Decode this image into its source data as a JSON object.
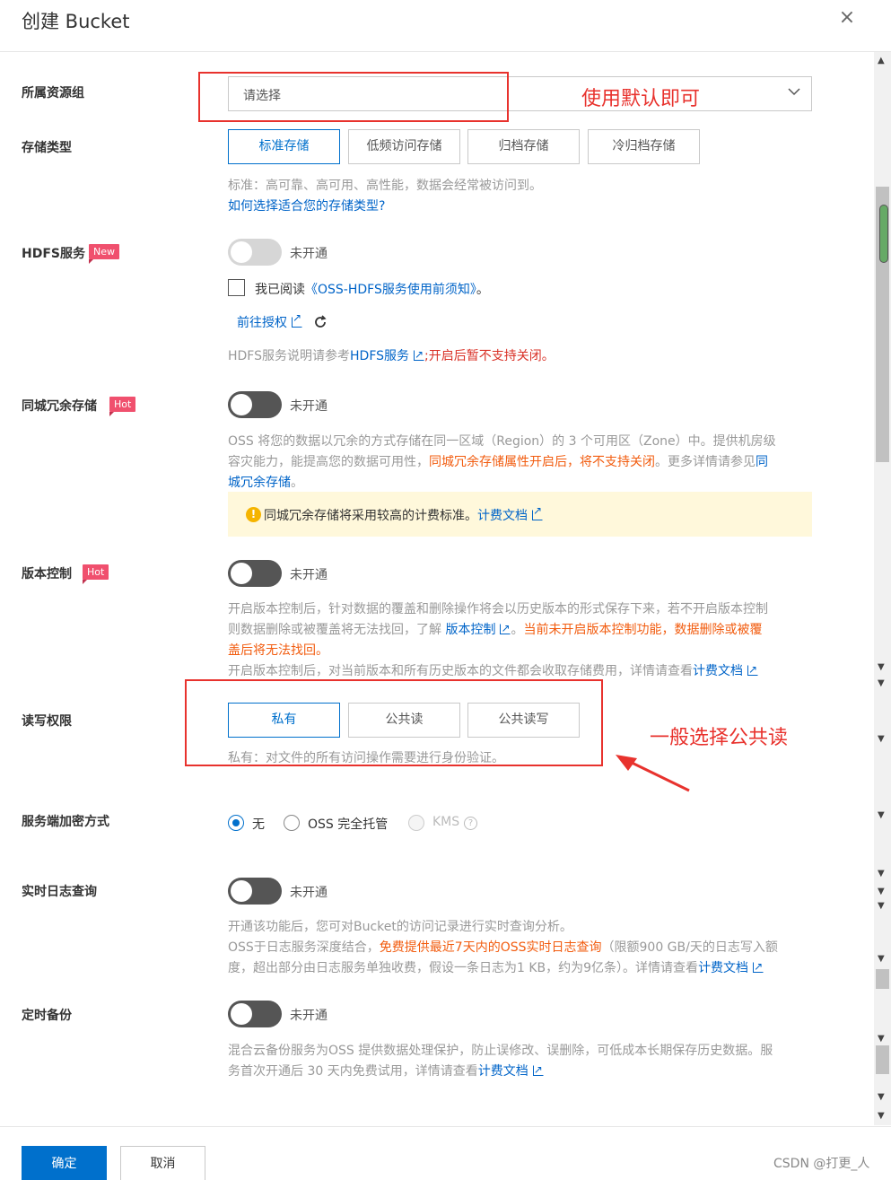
{
  "dialog": {
    "title": "创建 Bucket",
    "close": "×"
  },
  "resource_group": {
    "label": "所属资源组",
    "placeholder": "请选择"
  },
  "storage_type": {
    "label": "存储类型",
    "options": [
      "标准存储",
      "低频访问存储",
      "归档存储",
      "冷归档存储"
    ],
    "selected": "标准存储",
    "hint": "标准：高可靠、高可用、高性能，数据会经常被访问到。",
    "link": "如何选择适合您的存储类型?"
  },
  "hdfs": {
    "label": "HDFS服务",
    "badge": "New",
    "toggle_text": "未开通",
    "agree_prefix": "我已阅读",
    "agree_link": "《OSS-HDFS服务使用前须知》",
    "agree_suffix": "。",
    "auth_link": "前往授权",
    "hint_prefix": "HDFS服务说明请参考",
    "hint_link": "HDFS服务",
    "hint_red": ";开启后暂不支持关闭。"
  },
  "zrs": {
    "label": "同城冗余存储",
    "badge": "Hot",
    "toggle_text": "未开通",
    "desc1": "OSS 将您的数据以冗余的方式存储在同一区域（Region）的 3 个可用区（Zone）中。提供机房级",
    "desc2a": "容灾能力，能提高您的数据可用性，",
    "desc2_orange": "同城冗余存储属性开启后，将不支持关闭",
    "desc2b": "。更多详情请参见",
    "desc2_link": "同",
    "desc3_link": "城冗余存储",
    "desc3b": "。",
    "warn_icon": "!",
    "warn_text": "同城冗余存储将采用较高的计费标准。",
    "warn_link": "计费文档"
  },
  "versioning": {
    "label": "版本控制",
    "badge": "Hot",
    "toggle_text": "未开通",
    "desc1": "开启版本控制后，针对数据的覆盖和删除操作将会以历史版本的形式保存下来，若不开启版本控制",
    "desc2a": "则数据删除或被覆盖将无法找回，了解",
    "desc2_link": "版本控制",
    "desc2_orange": "当前未开启版本控制功能，数据删除或被覆",
    "desc3_orange": "盖后将无法找回。",
    "desc4": "开启版本控制后，对当前版本和所有历史版本的文件都会收取存储费用，详情请查看",
    "desc4_link": "计费文档"
  },
  "acl": {
    "label": "读写权限",
    "options": [
      "私有",
      "公共读",
      "公共读写"
    ],
    "selected": "私有",
    "hint": "私有：对文件的所有访问操作需要进行身份验证。"
  },
  "encryption": {
    "label": "服务端加密方式",
    "options": [
      "无",
      "OSS 完全托管",
      "KMS"
    ],
    "selected": "无",
    "kms_help": "?"
  },
  "realtime_log": {
    "label": "实时日志查询",
    "toggle_text": "未开通",
    "desc1": "开通该功能后，您可对Bucket的访问记录进行实时查询分析。",
    "desc2a": "OSS于日志服务深度结合，",
    "desc2_orange": "免费提供最近7天内的OSS实时日志查询",
    "desc2b": "（限额900 GB/天的日志写入额",
    "desc3": "度，超出部分由日志服务单独收费，假设一条日志为1 KB，约为9亿条）。详情请查看",
    "desc3_link": "计费文档"
  },
  "backup": {
    "label": "定时备份",
    "toggle_text": "未开通",
    "desc1": "混合云备份服务为OSS 提供数据处理保护，防止误修改、误删除，可低成本长期保存历史数据。服",
    "desc2": "务首次开通后 30 天内免费试用，详情请查看",
    "desc2_link": "计费文档"
  },
  "footer": {
    "confirm": "确定",
    "cancel": "取消",
    "watermark": "CSDN @打更_人"
  },
  "annotations": {
    "default_note": "使用默认即可",
    "acl_note": "一般选择公共读",
    "color": "#e8322d"
  },
  "colors": {
    "primary": "#0070cc",
    "link": "#0064c8",
    "badge": "#f0506e",
    "warn_bg": "#fff8db"
  }
}
